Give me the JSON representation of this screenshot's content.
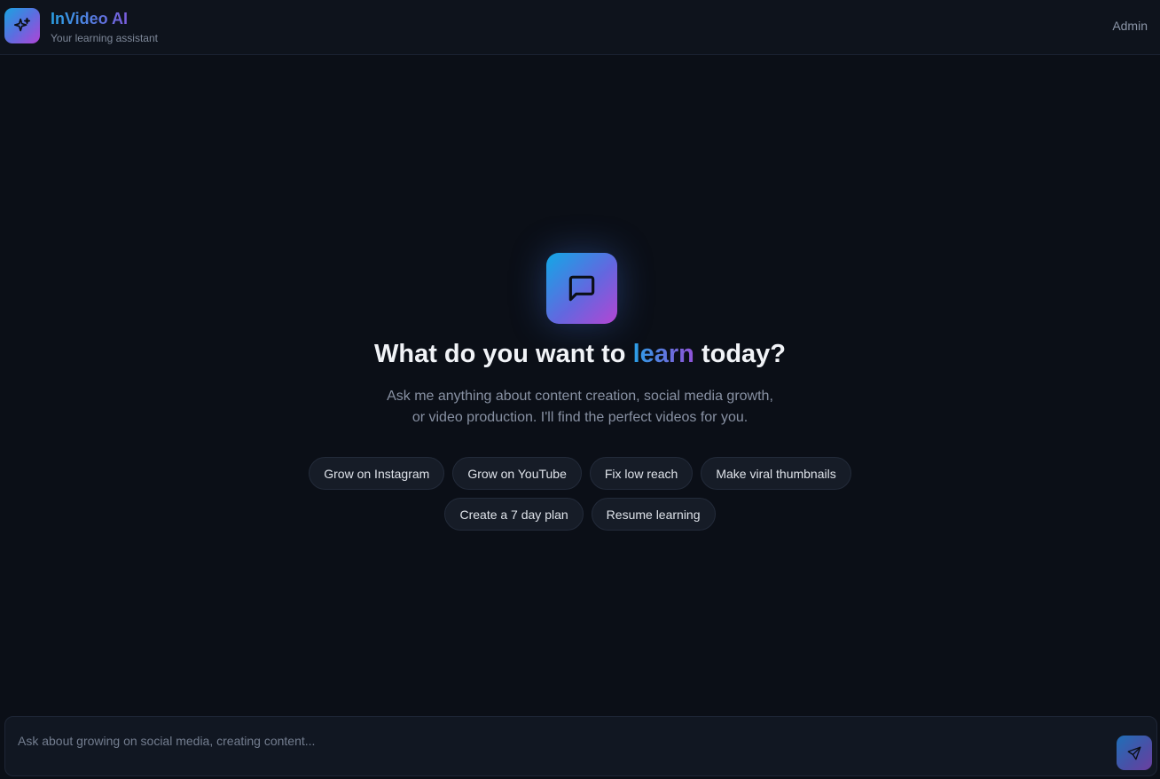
{
  "header": {
    "brand_title": "InVideo AI",
    "brand_subtitle": "Your learning assistant",
    "admin_label": "Admin",
    "logo_icon": "sparkles-icon"
  },
  "hero": {
    "icon": "chat-bubble-icon",
    "title_before": "What do you want to ",
    "title_accent": "learn",
    "title_after": " today?",
    "description_line1": "Ask me anything about content creation, social media growth,",
    "description_line2": "or video production. I'll find the perfect videos for you."
  },
  "suggestions": [
    "Grow on Instagram",
    "Grow on YouTube",
    "Fix low reach",
    "Make viral thumbnails",
    "Create a 7 day plan",
    "Resume learning"
  ],
  "composer": {
    "placeholder": "Ask about growing on social media, creating content...",
    "value": "",
    "send_icon": "send-icon"
  },
  "colors": {
    "background": "#0b0f17",
    "accent_start": "#1aa3e0",
    "accent_end": "#b044d6"
  }
}
